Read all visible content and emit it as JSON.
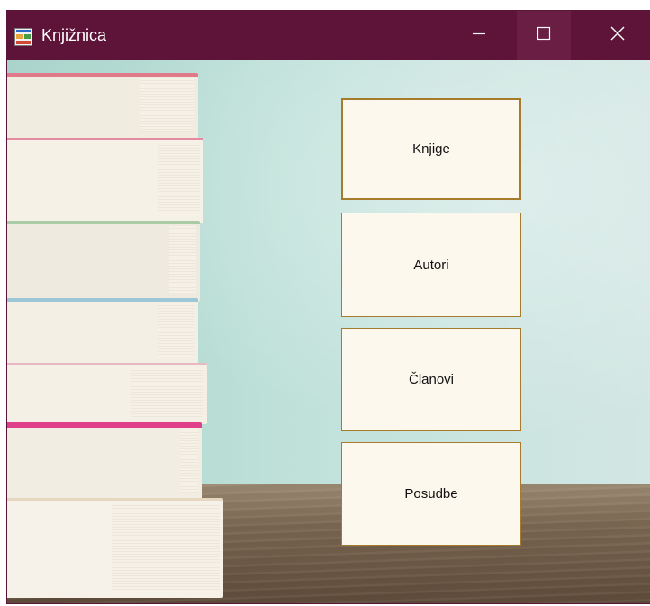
{
  "window": {
    "title": "Knjižnica",
    "icon": "app-form-icon",
    "controls": {
      "minimize_icon": "minimize-icon",
      "maximize_icon": "maximize-icon",
      "close_icon": "close-icon"
    }
  },
  "menu": {
    "buttons": [
      {
        "label": "Knjige"
      },
      {
        "label": "Autori"
      },
      {
        "label": "Članovi"
      },
      {
        "label": "Posudbe"
      }
    ]
  },
  "colors": {
    "titlebar": "#5e1438",
    "button_bg": "#fdf8ee",
    "button_border": "#a67c2c"
  }
}
